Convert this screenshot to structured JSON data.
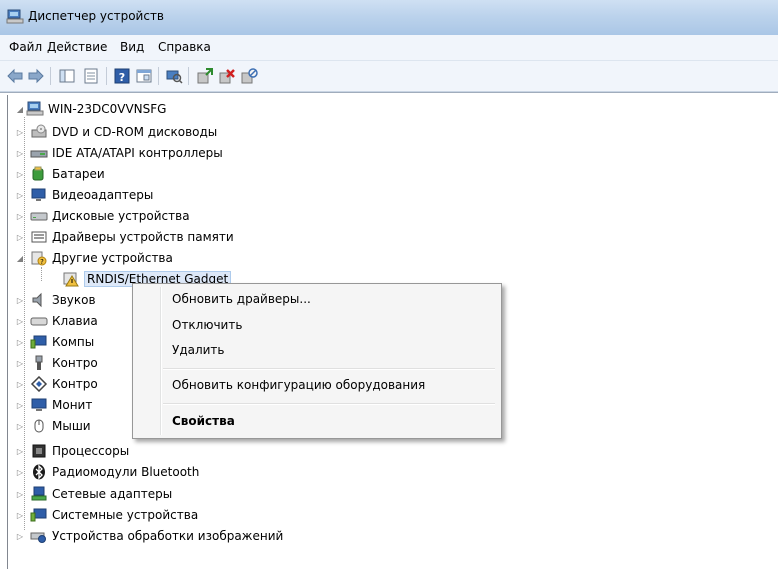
{
  "window": {
    "title": "Диспетчер устройств"
  },
  "menu": [
    "Файл",
    "Действие",
    "Вид",
    "Справка"
  ],
  "toolbar_icons": [
    "back-arrow-icon",
    "forward-arrow-icon",
    "console-tree-icon",
    "properties-icon",
    "help-icon",
    "view-icon",
    "scan-hardware-icon",
    "update-driver-icon",
    "uninstall-icon",
    "disable-icon"
  ],
  "tree": {
    "root": "WIN-23DC0VVNSFG",
    "items": [
      {
        "label": "DVD и CD-ROM дисководы",
        "icon": "dvd-icon"
      },
      {
        "label": "IDE ATA/ATAPI контроллеры",
        "icon": "ide-controller-icon"
      },
      {
        "label": "Батареи",
        "icon": "battery-icon"
      },
      {
        "label": "Видеоадаптеры",
        "icon": "display-adapter-icon"
      },
      {
        "label": "Дисковые устройства",
        "icon": "disk-drive-icon"
      },
      {
        "label": "Драйверы устройств памяти",
        "icon": "memory-device-icon"
      },
      {
        "label": "Другие устройства",
        "icon": "other-devices-icon"
      },
      {
        "label": "RNDIS/Ethernet Gadget",
        "icon": "warning-device-icon"
      },
      {
        "label": "Звуков",
        "icon": "sound-icon"
      },
      {
        "label": "Клавиа",
        "icon": "keyboard-icon"
      },
      {
        "label": "Компы",
        "icon": "computer-icon"
      },
      {
        "label": "Контро",
        "icon": "usb-controller-icon"
      },
      {
        "label": "Контро",
        "icon": "controller-icon"
      },
      {
        "label": "Монит",
        "icon": "monitor-icon"
      },
      {
        "label": "Мыши",
        "icon": "mouse-icon"
      },
      {
        "label": "Процессоры",
        "icon": "processor-icon"
      },
      {
        "label": "Радиомодули Bluetooth",
        "icon": "bluetooth-icon"
      },
      {
        "label": "Сетевые адаптеры",
        "icon": "network-adapter-icon"
      },
      {
        "label": "Системные устройства",
        "icon": "system-device-icon"
      },
      {
        "label": "Устройства обработки изображений",
        "icon": "imaging-device-icon"
      }
    ]
  },
  "context_menu": {
    "update_drivers": "Обновить драйверы...",
    "disable": "Отключить",
    "delete": "Удалить",
    "scan_hardware": "Обновить конфигурацию оборудования",
    "properties": "Свойства"
  }
}
